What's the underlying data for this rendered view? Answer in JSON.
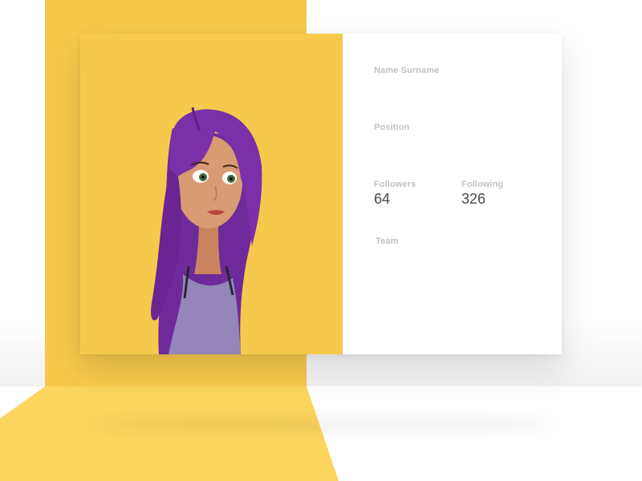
{
  "profile": {
    "name_label": "Name Surname",
    "position_label": "Position",
    "followers_label": "Followers",
    "followers_value": "64",
    "following_label": "Following",
    "following_value": "326",
    "team_label": "Team"
  },
  "avatar": {
    "icon": "cartoon-girl-purple-hair",
    "hair_color": "#7b2fa8",
    "top_color": "#9486b9"
  },
  "colors": {
    "accent": "#f7c94a",
    "card_photo_bg": "#f6c94c",
    "label": "#c2c2c2",
    "value": "#4a4a4a"
  }
}
